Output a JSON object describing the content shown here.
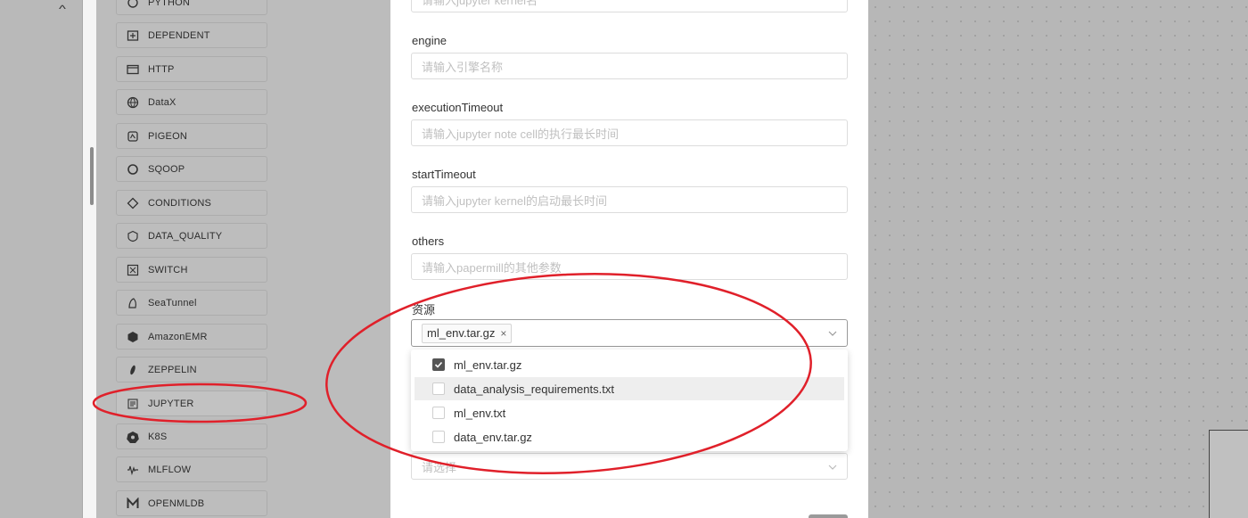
{
  "tasks": [
    {
      "label": "PYTHON",
      "icon": "python-icon"
    },
    {
      "label": "DEPENDENT",
      "icon": "dependent-icon"
    },
    {
      "label": "HTTP",
      "icon": "http-icon"
    },
    {
      "label": "DataX",
      "icon": "datax-icon"
    },
    {
      "label": "PIGEON",
      "icon": "pigeon-icon"
    },
    {
      "label": "SQOOP",
      "icon": "sqoop-icon"
    },
    {
      "label": "CONDITIONS",
      "icon": "conditions-icon"
    },
    {
      "label": "DATA_QUALITY",
      "icon": "data-quality-icon"
    },
    {
      "label": "SWITCH",
      "icon": "switch-icon"
    },
    {
      "label": "SeaTunnel",
      "icon": "seatunnel-icon"
    },
    {
      "label": "AmazonEMR",
      "icon": "amazonemr-icon"
    },
    {
      "label": "ZEPPELIN",
      "icon": "zeppelin-icon"
    },
    {
      "label": "JUPYTER",
      "icon": "jupyter-icon"
    },
    {
      "label": "K8S",
      "icon": "k8s-icon"
    },
    {
      "label": "MLFLOW",
      "icon": "mlflow-icon"
    },
    {
      "label": "OPENMLDB",
      "icon": "openmldb-icon"
    }
  ],
  "form": {
    "kernel_placeholder": "请输入jupyter kernel名",
    "engine_label": "engine",
    "engine_placeholder": "请输入引擎名称",
    "execution_timeout_label": "executionTimeout",
    "execution_timeout_placeholder": "请输入jupyter note cell的执行最长时间",
    "start_timeout_label": "startTimeout",
    "start_timeout_placeholder": "请输入jupyter kernel的启动最长时间",
    "others_label": "others",
    "others_placeholder": "请输入papermill的其他参数",
    "resources_label": "资源",
    "selected_tag": "ml_env.tar.gz",
    "tag_close": "×",
    "next_select_placeholder": "请选择"
  },
  "dropdown": {
    "options": [
      {
        "label": "ml_env.tar.gz",
        "checked": true
      },
      {
        "label": "data_analysis_requirements.txt",
        "checked": false
      },
      {
        "label": "ml_env.txt",
        "checked": false
      },
      {
        "label": "data_env.tar.gz",
        "checked": false
      }
    ]
  },
  "sidebar": {
    "collapse_icon": "chevron-up-icon",
    "collapse_glyph": "^"
  },
  "colors": {
    "annotation": "#e0202a",
    "checkbox_checked": "#555555",
    "overlay": "#bcbcbc"
  }
}
